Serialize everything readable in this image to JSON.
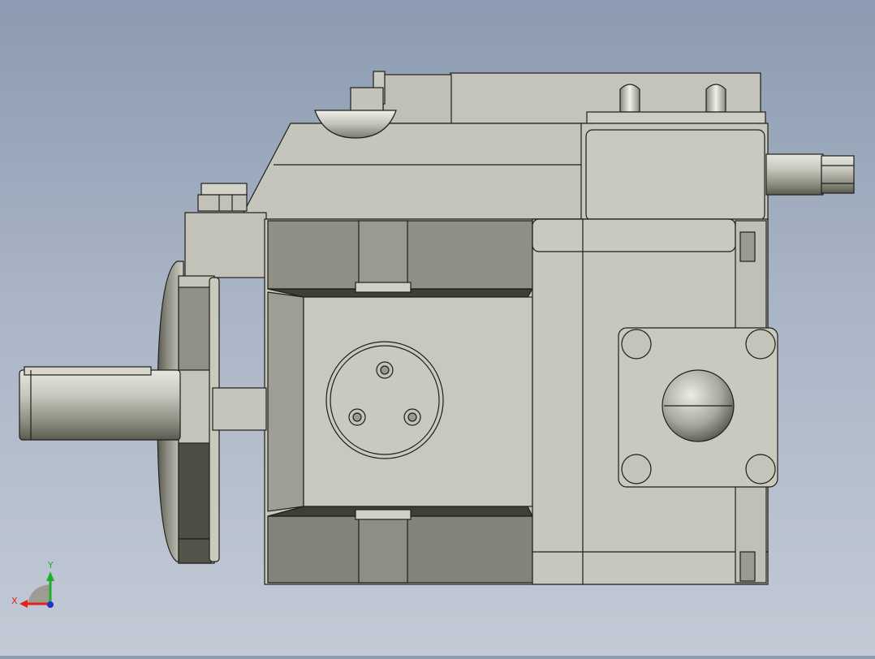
{
  "viewport": {
    "background_top": "#8c9bb1",
    "background_bottom": "#c3cad6",
    "model_color": "#c7c7bd",
    "model_shadow": "#4b4b42",
    "edge_color": "#1f1f1a"
  },
  "triad": {
    "x_label": "X",
    "y_label": "Y",
    "x_color": "#e0241b",
    "y_color": "#1fae2a",
    "z_color": "#1b35c9"
  }
}
